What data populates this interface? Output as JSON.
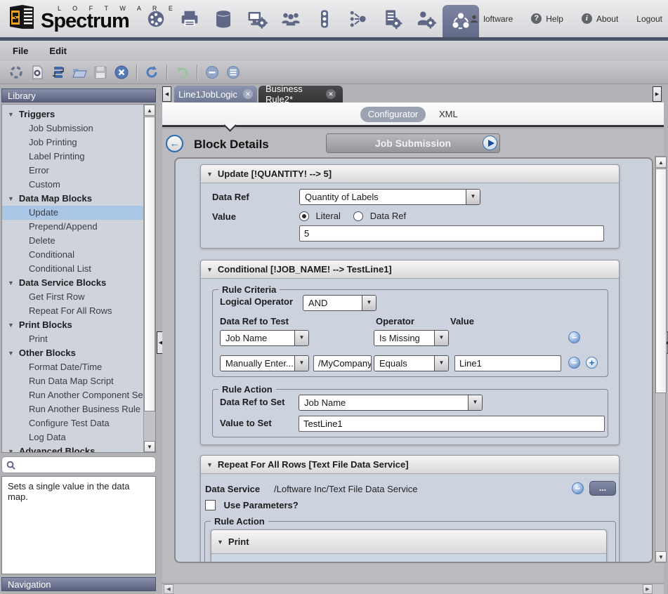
{
  "colors": {
    "accent_blue": "#2a6cb4",
    "header_dark": "#4b5268",
    "panel_header": "#59617f",
    "selection": "#a9c6e6",
    "active_tab": "#353537",
    "block_body": "#ccd3de"
  },
  "header": {
    "brand_top": "L O F T W A R E",
    "brand_name": "Spectrum",
    "nav_icons": [
      "palette-icon",
      "printer-icon",
      "database-icon",
      "workstation-gear-icon",
      "users-icon",
      "traffic-light-icon",
      "data-flow-icon",
      "server-gear-icon",
      "user-gear-icon",
      "processes-icon"
    ],
    "active_nav_icon": "processes-icon",
    "username": "loftware",
    "help_label": "Help",
    "about_label": "About",
    "logout_label": "Logout"
  },
  "menu": {
    "items": [
      "File",
      "Edit"
    ],
    "file": "File",
    "edit": "Edit"
  },
  "toolbar": {
    "icons": [
      "component-set-icon",
      "new-rule-document-icon",
      "blocks-icon",
      "open-folder-icon",
      "save-icon",
      "close-circle-icon",
      "refresh-icon",
      "undo-icon",
      "collapse-icon",
      "collapse-all-icon"
    ]
  },
  "sidebar": {
    "library_title": "Library",
    "tree": [
      {
        "label": "Triggers",
        "type": "group"
      },
      {
        "label": "Job Submission",
        "type": "item"
      },
      {
        "label": "Job Printing",
        "type": "item"
      },
      {
        "label": "Label Printing",
        "type": "item"
      },
      {
        "label": "Error",
        "type": "item"
      },
      {
        "label": "Custom",
        "type": "item"
      },
      {
        "label": "Data Map Blocks",
        "type": "group"
      },
      {
        "label": "Update",
        "type": "item",
        "selected": true
      },
      {
        "label": "Prepend/Append",
        "type": "item"
      },
      {
        "label": "Delete",
        "type": "item"
      },
      {
        "label": "Conditional",
        "type": "item"
      },
      {
        "label": "Conditional List",
        "type": "item"
      },
      {
        "label": "Data Service Blocks",
        "type": "group"
      },
      {
        "label": "Get First Row",
        "type": "item"
      },
      {
        "label": "Repeat For All Rows",
        "type": "item"
      },
      {
        "label": "Print Blocks",
        "type": "group"
      },
      {
        "label": "Print",
        "type": "item"
      },
      {
        "label": "Other Blocks",
        "type": "group"
      },
      {
        "label": "Format Date/Time",
        "type": "item"
      },
      {
        "label": "Run Data Map Script",
        "type": "item"
      },
      {
        "label": "Run Another Component Set",
        "type": "item"
      },
      {
        "label": "Run Another Business Rule",
        "type": "item"
      },
      {
        "label": "Configure Test Data",
        "type": "item"
      },
      {
        "label": "Log Data",
        "type": "item"
      },
      {
        "label": "Advanced Blocks",
        "type": "group"
      }
    ],
    "search_value": "",
    "description": "Sets a single value in the data map.",
    "navigation_title": "Navigation"
  },
  "tabs": [
    {
      "label": "Line1JobLogic"
    },
    {
      "label": "Business Rule2*"
    }
  ],
  "view_toggle": {
    "configurator": "Configurator",
    "xml": "XML"
  },
  "main": {
    "page_title": "Block Details",
    "block_selector": "Job Submission",
    "update_block": {
      "title": "Update [!QUANTITY! --> 5]",
      "data_ref_label": "Data Ref",
      "data_ref_value": "Quantity of Labels",
      "value_label": "Value",
      "literal_radio_label": "Literal",
      "data_ref_radio_label": "Data Ref",
      "value_input": "5"
    },
    "conditional_block": {
      "title": "Conditional [!JOB_NAME! --> TestLine1]",
      "rule_criteria_legend": "Rule Criteria",
      "logical_operator_label": "Logical Operator",
      "logical_operator_value": "AND",
      "col_data_ref_to_test": "Data Ref to Test",
      "col_operator": "Operator",
      "col_value": "Value",
      "row1_data_ref": "Job Name",
      "row1_operator": "Is Missing",
      "row2_data_ref": "Manually Enter...",
      "row2_path_value": "/MyCompany/L",
      "row2_operator": "Equals",
      "row2_value": "Line1",
      "rule_action_legend": "Rule Action",
      "data_ref_to_set_label": "Data Ref to Set",
      "data_ref_to_set_value": "Job Name",
      "value_to_set_label": "Value to Set",
      "value_to_set_value": "TestLine1"
    },
    "repeat_block": {
      "title": "Repeat For All Rows [Text File Data Service]",
      "data_service_label": "Data Service",
      "data_service_value": "/Loftware Inc/Text File Data Service",
      "browse_button": "...",
      "use_parameters_label": "Use Parameters?",
      "rule_action_legend": "Rule Action",
      "print_block_title": "Print"
    }
  }
}
